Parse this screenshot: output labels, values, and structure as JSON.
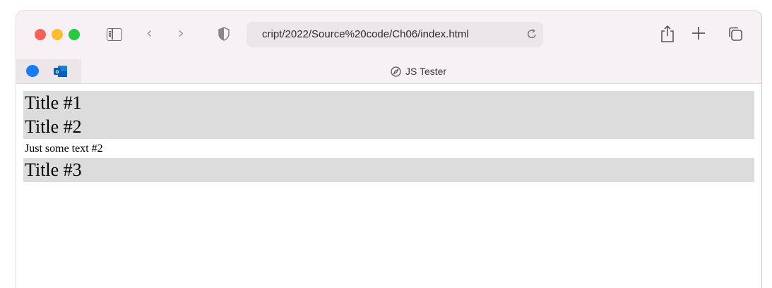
{
  "browser": {
    "url": "cript/2022/Source%20code/Ch06/index.html",
    "tab_title": "JS Tester",
    "icons": {
      "sidebar": "sidebar-icon",
      "back": "chevron-left-icon",
      "forward": "chevron-right-icon",
      "privacy": "shield-icon",
      "reload": "reload-icon",
      "share": "share-icon",
      "new_tab": "plus-icon",
      "tabs": "tab-overview-icon",
      "favorites": [
        "messages-icon",
        "outlook-icon"
      ],
      "tab": "compass-icon"
    }
  },
  "page": {
    "blocks": [
      {
        "type": "title",
        "text": "Title #1"
      },
      {
        "type": "title",
        "text": "Title #2"
      },
      {
        "type": "text",
        "text": "Just some text #2"
      },
      {
        "type": "title",
        "text": "Title #3"
      }
    ]
  },
  "colors": {
    "highlight": "#dcdcdc",
    "toolbar": "#f7f0f4"
  }
}
